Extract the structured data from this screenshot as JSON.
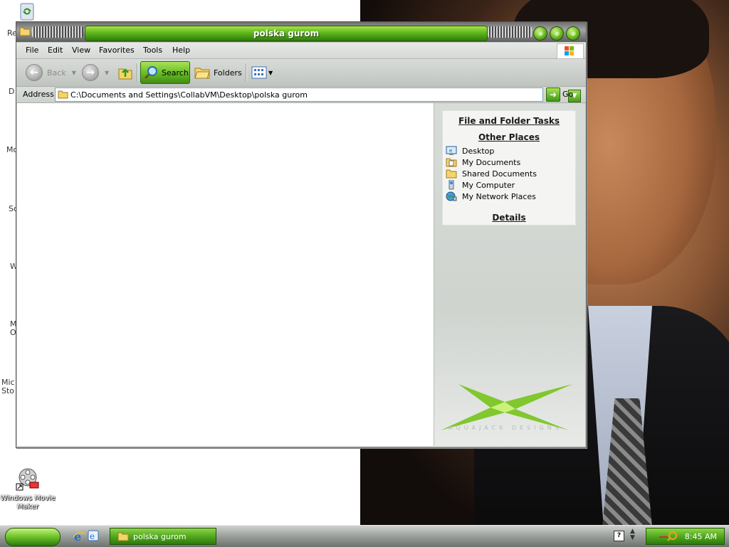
{
  "window": {
    "title": "polska gurom"
  },
  "menubar": {
    "items": [
      "File",
      "Edit",
      "View",
      "Favorites",
      "Tools",
      "Help"
    ]
  },
  "toolbar": {
    "back_label": "Back",
    "search_label": "Search",
    "folders_label": "Folders"
  },
  "address": {
    "label": "Address",
    "value": "C:\\Documents and Settings\\CollabVM\\Desktop\\polska gurom",
    "go_label": "Go"
  },
  "task_pane": {
    "file_folder_tasks": "File and Folder Tasks",
    "other_places_heading": "Other Places",
    "places": [
      {
        "label": "Desktop",
        "icon": "desktop-icon"
      },
      {
        "label": "My Documents",
        "icon": "my-documents-icon"
      },
      {
        "label": "Shared Documents",
        "icon": "shared-documents-icon"
      },
      {
        "label": "My Computer",
        "icon": "my-computer-icon"
      },
      {
        "label": "My Network Places",
        "icon": "my-network-places-icon"
      }
    ],
    "details_heading": "Details",
    "brand_text": "AQUAJACK DESIGNS"
  },
  "desktop": {
    "movie_maker_label": "Windows Movie Maker",
    "partial_labels": [
      "Re",
      "D",
      "Mo",
      "Sc",
      "W",
      "M\nO",
      "Mic\nSto"
    ]
  },
  "taskbar": {
    "window_button_label": "polska gurom",
    "clock": "8:45 AM"
  },
  "colors": {
    "accent_green": "#5fb81d",
    "title_text": "#ffffff"
  }
}
